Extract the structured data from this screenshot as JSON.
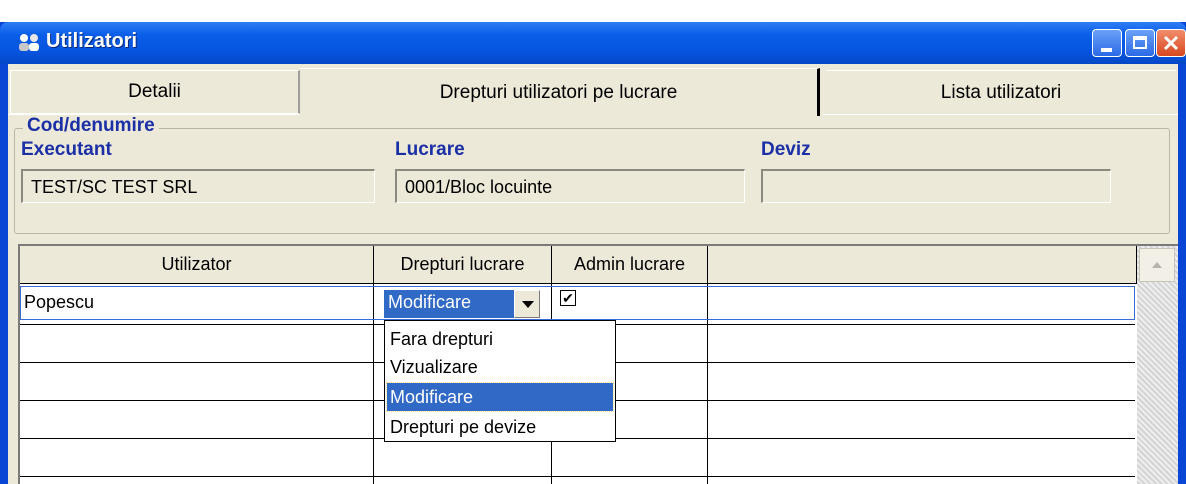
{
  "window": {
    "title": "Utilizatori",
    "controls": [
      "minimize-icon",
      "maximize-icon",
      "close-icon"
    ]
  },
  "tabs": [
    {
      "label": "Detalii",
      "active": false
    },
    {
      "label": "Drepturi utilizatori pe lucrare",
      "active": true
    },
    {
      "label": "Lista utilizatori",
      "active": false
    }
  ],
  "group": {
    "title": "Cod/denumire",
    "executant_label": "Executant",
    "executant_value": "TEST/SC TEST SRL",
    "lucrare_label": "Lucrare",
    "lucrare_value": "0001/Bloc locuinte",
    "deviz_label": "Deviz",
    "deviz_value": ""
  },
  "grid": {
    "columns": [
      "Utilizator",
      "Drepturi lucrare",
      "Admin lucrare"
    ],
    "rows": [
      {
        "utilizator": "Popescu",
        "drepturi": "Modificare",
        "admin": true
      }
    ]
  },
  "dropdown": {
    "options": [
      "Fara drepturi",
      "Vizualizare",
      "Modificare",
      "Drepturi pe devize"
    ],
    "selected": "Modificare"
  },
  "colors": {
    "title_bar": "#0a5ee9",
    "label_blue": "#1b2fa6",
    "selection": "#3169c6",
    "face": "#ece9d8"
  }
}
